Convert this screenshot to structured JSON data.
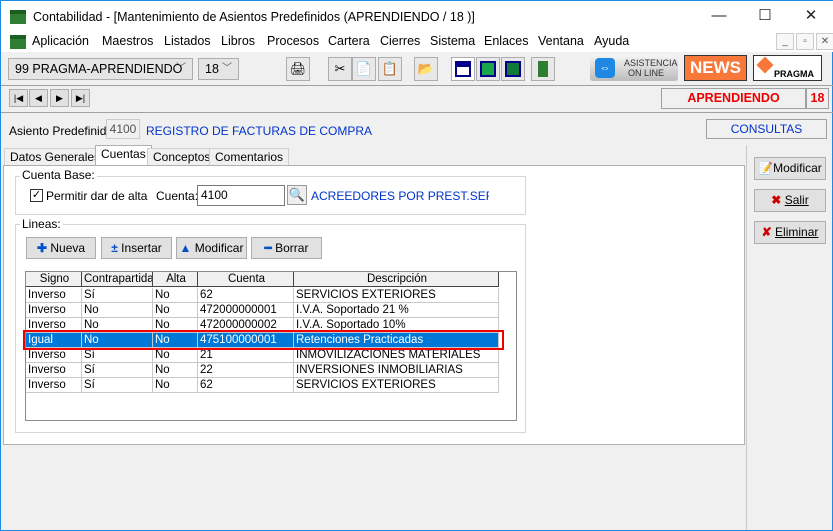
{
  "window": {
    "title": "Contabilidad - [Mantenimiento de Asientos Predefinidos (APRENDIENDO / 18 )]",
    "minimize": "—",
    "maximize": "☐",
    "close": "✕"
  },
  "menu": [
    "Aplicación",
    "Maestros",
    "Listados",
    "Libros",
    "Procesos",
    "Cartera",
    "Cierres",
    "Sistema",
    "Enlaces",
    "Ventana",
    "Ayuda"
  ],
  "toolbar": {
    "company": "99  PRAGMA-APRENDIENDO",
    "period": "18",
    "asistencia_line1": "ASISTENCIA",
    "asistencia_line2": "ON LINE",
    "news": "NEWS",
    "pragma": "PRAGMA"
  },
  "status": {
    "company": "APRENDIENDO",
    "number": "18",
    "mode": "CONSULTAS"
  },
  "header": {
    "label": "Asiento Predefinido:",
    "code": "4100",
    "description": "REGISTRO DE FACTURAS DE COMPRA"
  },
  "tabs": [
    "Datos Generales",
    "Cuentas",
    "Conceptos",
    "Comentarios"
  ],
  "cuenta_base": {
    "title": "Cuenta Base:",
    "checkbox_label": "Permitir dar de alta",
    "checked": true,
    "cuenta_label": "Cuenta:",
    "cuenta_value": "4100",
    "cuenta_desc": "ACREEDORES POR PREST.SERV(("
  },
  "lineas": {
    "title": "Lineas:",
    "buttons": [
      "Nueva",
      "Insertar",
      "Modificar",
      "Borrar"
    ],
    "columns": [
      "Signo",
      "Contrapartida",
      "Alta",
      "Cuenta",
      "Descripción"
    ],
    "rows": [
      [
        "Inverso",
        "Sí",
        "No",
        "62",
        "SERVICIOS EXTERIORES"
      ],
      [
        "Inverso",
        "No",
        "No",
        "472000000001",
        "I.V.A. Soportado 21 %"
      ],
      [
        "Inverso",
        "No",
        "No",
        "472000000002",
        "I.V.A. Soportado 10%"
      ],
      [
        "Igual",
        "No",
        "No",
        "475100000001",
        "Retenciones Practicadas"
      ],
      [
        "Inverso",
        "Sí",
        "No",
        "21",
        "INMOVILIZACIONES MATERIALES"
      ],
      [
        "Inverso",
        "Sí",
        "No",
        "22",
        "INVERSIONES INMOBILIARIAS"
      ],
      [
        "Inverso",
        "Sí",
        "No",
        "62",
        "SERVICIOS EXTERIORES"
      ]
    ],
    "selected_row": 3
  },
  "actions": {
    "modificar": "Modificar",
    "salir": "Salir",
    "eliminar": "Eliminar"
  }
}
